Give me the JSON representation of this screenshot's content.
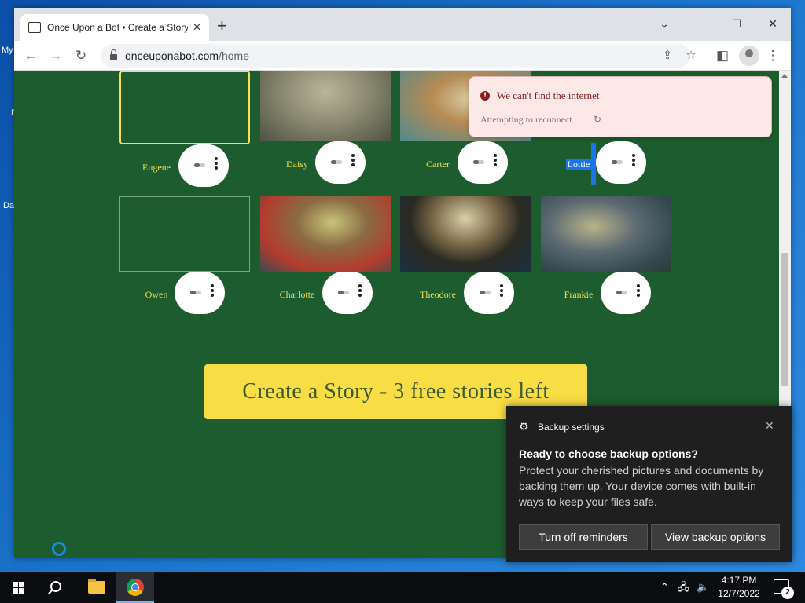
{
  "desktop": {
    "labels": [
      "My",
      "D",
      "Da"
    ]
  },
  "browser": {
    "tab_title": "Once Upon a Bot • Create a Story",
    "tab_close": "✕",
    "new_tab": "+",
    "controls": {
      "minimize": "⌄",
      "restore": "☐",
      "close": "✕"
    },
    "url_host": "onceuponabot.com",
    "url_path": "/home"
  },
  "characters": [
    {
      "name": "Eugene",
      "image": "broken",
      "selected": true
    },
    {
      "name": "Daisy",
      "image": "portrait-elderly-woman-glasses"
    },
    {
      "name": "Carter",
      "image": "portrait-elderly-man-glasses"
    },
    {
      "name": "Lottie",
      "image": "portrait",
      "text_highlighted": true
    },
    {
      "name": "Owen",
      "image": "broken"
    },
    {
      "name": "Charlotte",
      "image": "portrait-woman-red-jacket"
    },
    {
      "name": "Theodore",
      "image": "portrait-man-cowboy-hat"
    },
    {
      "name": "Frankie",
      "image": "portrait-old-man-reading"
    }
  ],
  "cta": {
    "label": "Create a Story - 3 free stories left",
    "bg_color": "#f9dd45"
  },
  "offline_toast": {
    "title": "We can't find the internet",
    "subtitle": "Attempting to reconnect",
    "icon": "error-icon"
  },
  "notification": {
    "app_name": "Backup settings",
    "heading": "Ready to choose backup options?",
    "body": "Protect your cherished pictures and documents by backing them up. Your device comes with built-in ways to keep your files safe.",
    "button_dismiss": "Turn off reminders",
    "button_primary": "View backup options"
  },
  "taskbar": {
    "time": "4:17 PM",
    "date": "12/7/2022",
    "notification_count": "2"
  },
  "colors": {
    "page_bg": "#1d5c2e",
    "name_text": "#f4de5a",
    "selection": "#1a73e8"
  }
}
